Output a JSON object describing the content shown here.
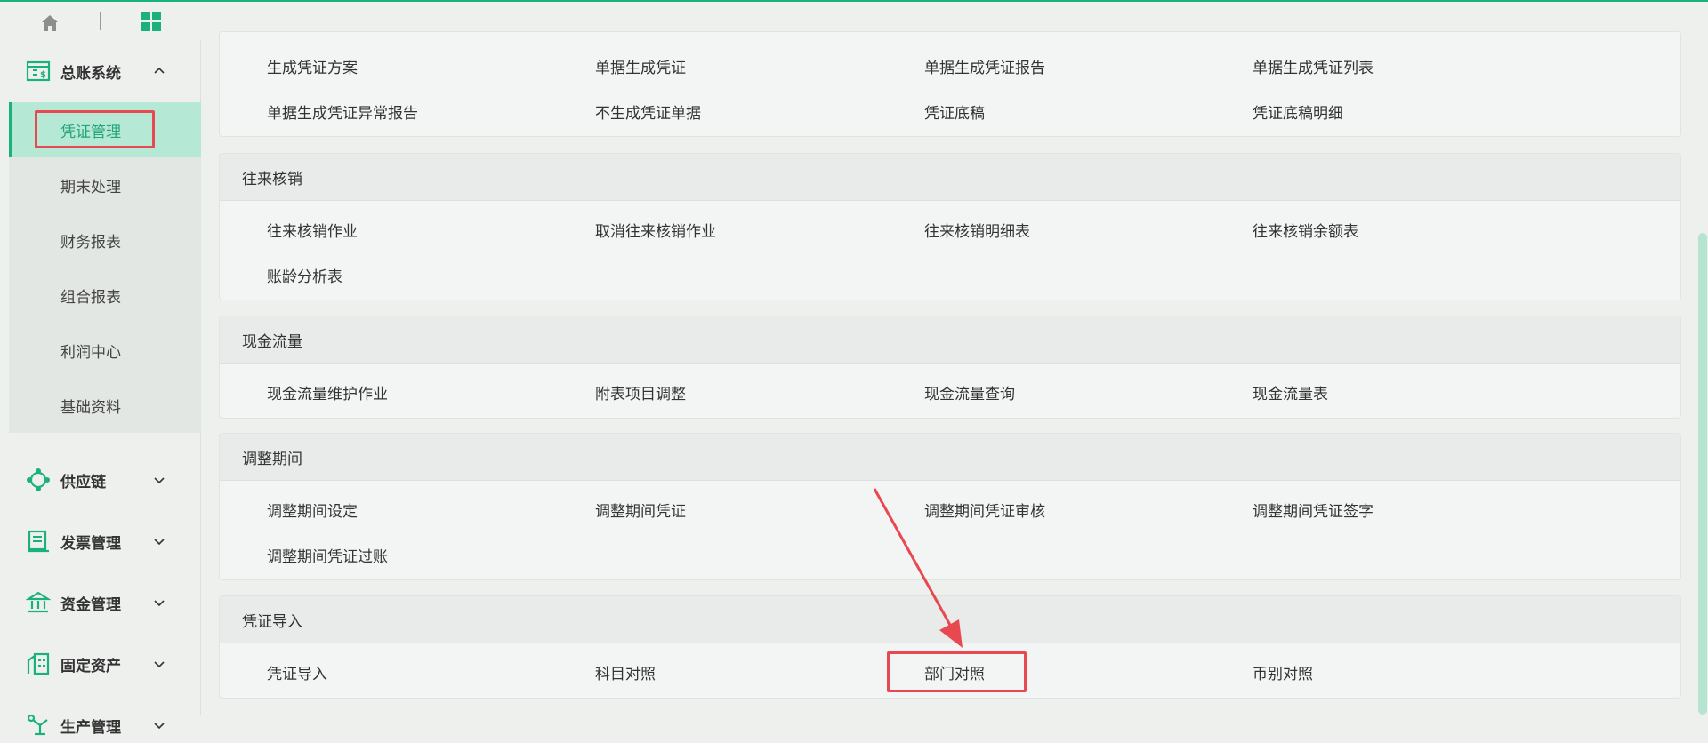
{
  "topbar": {
    "home_icon": "home-icon",
    "app_grid_icon": "app-grid-icon",
    "accent": "#1bb17c"
  },
  "sidebar": {
    "modules": [
      {
        "label": "总账系统",
        "icon": "ledger-icon",
        "expanded": true
      },
      {
        "label": "供应链",
        "icon": "supply-chain-icon",
        "expanded": false
      },
      {
        "label": "发票管理",
        "icon": "invoice-icon",
        "expanded": false
      },
      {
        "label": "资金管理",
        "icon": "bank-icon",
        "expanded": false
      },
      {
        "label": "固定资产",
        "icon": "building-icon",
        "expanded": false
      },
      {
        "label": "生产管理",
        "icon": "robot-arm-icon",
        "expanded": false
      }
    ],
    "submenu": [
      "凭证管理",
      "期末处理",
      "财务报表",
      "组合报表",
      "利润中心",
      "基础资料"
    ],
    "active_submenu": "凭证管理"
  },
  "cards": {
    "voucher_gen": {
      "items": [
        "生成凭证方案",
        "单据生成凭证",
        "单据生成凭证报告",
        "单据生成凭证列表",
        "单据生成凭证异常报告",
        "不生成凭证单据",
        "凭证底稿",
        "凭证底稿明细"
      ]
    },
    "writeoff": {
      "title": "往来核销",
      "items": [
        "往来核销作业",
        "取消往来核销作业",
        "往来核销明细表",
        "往来核销余额表",
        "账龄分析表"
      ]
    },
    "cashflow": {
      "title": "现金流量",
      "items": [
        "现金流量维护作业",
        "附表项目调整",
        "现金流量查询",
        "现金流量表"
      ]
    },
    "adjust": {
      "title": "调整期间",
      "items": [
        "调整期间设定",
        "调整期间凭证",
        "调整期间凭证审核",
        "调整期间凭证签字",
        "调整期间凭证过账"
      ]
    },
    "import": {
      "title": "凭证导入",
      "items": [
        "凭证导入",
        "科目对照",
        "部门对照",
        "币别对照"
      ]
    }
  },
  "colors": {
    "highlight": "#e8484f",
    "active_bg": "#b6e8d6",
    "active_text": "#22a57a"
  }
}
